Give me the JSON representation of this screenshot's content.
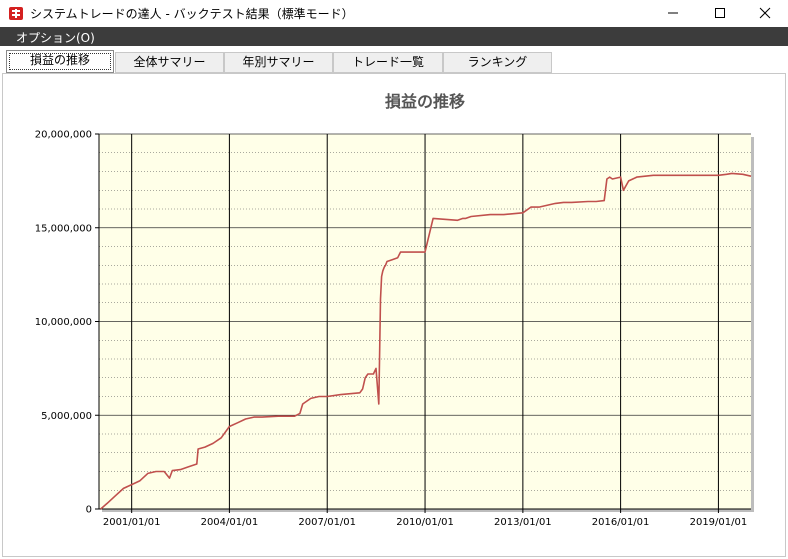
{
  "window": {
    "title": "システムトレードの達人 - バックテスト結果（標準モード）"
  },
  "menu": {
    "items": [
      {
        "label": "オプション(O)"
      }
    ]
  },
  "tabs": [
    {
      "label": "損益の推移",
      "active": true
    },
    {
      "label": "全体サマリー",
      "active": false
    },
    {
      "label": "年別サマリー",
      "active": false
    },
    {
      "label": "トレード一覧",
      "active": false
    },
    {
      "label": "ランキング",
      "active": false
    }
  ],
  "colors": {
    "plot_bg": "#ffffe8",
    "line": "#c0504d",
    "menubar": "#3c3c3c"
  },
  "icons": {
    "app": "app-logo-icon",
    "minimize": "minimize-icon",
    "maximize": "maximize-icon",
    "close": "close-icon"
  },
  "chart_data": {
    "type": "line",
    "title": "損益の推移",
    "xlabel": "",
    "ylabel": "",
    "ylim": [
      0,
      20000000
    ],
    "yticks": [
      0,
      5000000,
      10000000,
      15000000,
      20000000
    ],
    "ytick_labels": [
      "0",
      "5,000,000",
      "10,000,000",
      "15,000,000",
      "20,000,000"
    ],
    "xlim": [
      "2000-01-01",
      "2020-01-01"
    ],
    "xticks": [
      "2001-01-01",
      "2004-01-01",
      "2007-01-01",
      "2010-01-01",
      "2013-01-01",
      "2016-01-01",
      "2019-01-01"
    ],
    "xtick_labels": [
      "2001/01/01",
      "2004/01/01",
      "2007/01/01",
      "2010/01/01",
      "2013/01/01",
      "2016/01/01",
      "2019/01/01"
    ],
    "grid": true,
    "legend": "none",
    "series": [
      {
        "x": [
          "2000-01-20",
          "2000-04-01",
          "2000-07-01",
          "2000-10-01",
          "2001-01-01",
          "2001-04-01",
          "2001-07-01",
          "2001-10-01",
          "2002-01-01",
          "2002-03-01",
          "2002-04-01",
          "2002-07-01",
          "2002-10-01",
          "2003-01-01",
          "2003-01-15",
          "2003-04-01",
          "2003-07-01",
          "2003-10-01",
          "2004-01-01",
          "2004-04-01",
          "2004-07-01",
          "2004-10-01",
          "2005-01-01",
          "2005-07-01",
          "2006-01-01",
          "2006-03-01",
          "2006-04-01",
          "2006-07-01",
          "2006-10-01",
          "2007-01-01",
          "2007-06-01",
          "2008-01-01",
          "2008-02-01",
          "2008-03-01",
          "2008-04-01",
          "2008-06-01",
          "2008-07-01",
          "2008-08-01",
          "2008-08-20",
          "2008-09-01",
          "2008-09-15",
          "2008-10-01",
          "2008-10-15",
          "2008-11-01",
          "2009-01-01",
          "2009-03-01",
          "2009-04-01",
          "2009-07-01",
          "2010-01-01",
          "2010-04-01",
          "2011-01-01",
          "2011-03-01",
          "2011-04-01",
          "2011-06-01",
          "2012-01-01",
          "2012-06-01",
          "2013-01-01",
          "2013-04-01",
          "2013-07-01",
          "2014-01-01",
          "2014-04-01",
          "2014-07-01",
          "2015-01-01",
          "2015-04-01",
          "2015-07-01",
          "2015-08-01",
          "2015-09-01",
          "2015-10-01",
          "2016-01-01",
          "2016-02-01",
          "2016-04-01",
          "2016-07-01",
          "2017-01-01",
          "2018-01-01",
          "2019-01-01",
          "2019-04-01",
          "2019-06-01",
          "2019-10-01",
          "2020-01-01"
        ],
        "values": [
          0,
          300000,
          700000,
          1100000,
          1300000,
          1500000,
          1900000,
          2000000,
          2000000,
          1650000,
          2050000,
          2100000,
          2250000,
          2400000,
          3200000,
          3300000,
          3500000,
          3800000,
          4400000,
          4600000,
          4800000,
          4900000,
          4900000,
          4950000,
          4950000,
          5100000,
          5600000,
          5900000,
          6000000,
          6000000,
          6100000,
          6200000,
          6400000,
          7000000,
          7200000,
          7200000,
          7500000,
          5600000,
          11200000,
          12400000,
          12700000,
          12900000,
          13000000,
          13200000,
          13300000,
          13400000,
          13700000,
          13700000,
          13700000,
          15500000,
          15400000,
          15500000,
          15500000,
          15600000,
          15700000,
          15700000,
          15800000,
          16100000,
          16100000,
          16300000,
          16350000,
          16350000,
          16400000,
          16400000,
          16450000,
          17600000,
          17700000,
          17600000,
          17700000,
          17000000,
          17500000,
          17700000,
          17800000,
          17800000,
          17800000,
          17850000,
          17900000,
          17850000,
          17750000
        ]
      }
    ]
  }
}
